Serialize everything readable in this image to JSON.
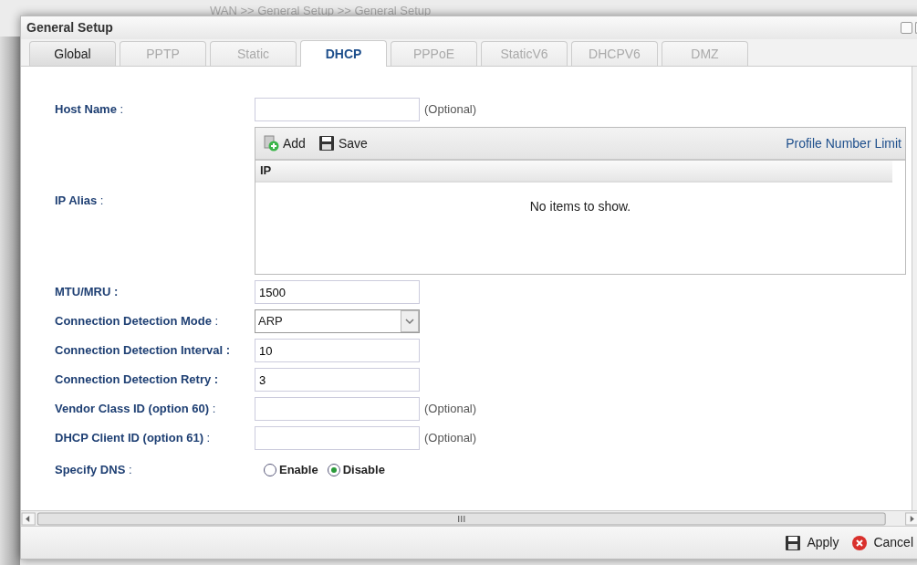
{
  "background": {
    "breadcrumb": "WAN >> General Setup >> General Setup"
  },
  "dialog": {
    "title": "General Setup"
  },
  "tabs": [
    {
      "label": "Global",
      "selected": false,
      "disabled": false
    },
    {
      "label": "PPTP",
      "selected": false,
      "disabled": true
    },
    {
      "label": "Static",
      "selected": false,
      "disabled": true
    },
    {
      "label": "DHCP",
      "selected": true,
      "disabled": false
    },
    {
      "label": "PPPoE",
      "selected": false,
      "disabled": true
    },
    {
      "label": "StaticV6",
      "selected": false,
      "disabled": true
    },
    {
      "label": "DHCPV6",
      "selected": false,
      "disabled": true
    },
    {
      "label": "DMZ",
      "selected": false,
      "disabled": true
    }
  ],
  "form": [
    {
      "kind": "text",
      "label": "**Host Name** :",
      "note": "(Optional)"
    },
    {
      "kind": "grid",
      "label": "**IP Alias** :",
      "toolbar": [
        {
          "kind": "add",
          "label": "Add"
        },
        {
          "kind": "save",
          "label": "Save"
        }
      ],
      "link": "Profile Number Limit",
      "columns": [
        "IP"
      ],
      "empty_text": "No items to show."
    },
    {
      "kind": "text",
      "label": "**MTU/MRU :**",
      "value": "1500"
    },
    {
      "kind": "select",
      "label": "**Connection Detection Mode** :",
      "value": "ARP"
    },
    {
      "kind": "text",
      "label": "**Connection Detection Interval :**",
      "value": "10"
    },
    {
      "kind": "text",
      "label": "**Connection Detection Retry :**",
      "value": "3"
    },
    {
      "kind": "text",
      "label": "**Vendor Class ID (option 60)** :",
      "note": "(Optional)"
    },
    {
      "kind": "text",
      "label": "**DHCP Client ID (option 61)** :",
      "note": "(Optional)"
    },
    {
      "kind": "radio",
      "label": "**Specify DNS** :",
      "options": [
        {
          "label": "Enable",
          "selected": false
        },
        {
          "label": "Disable",
          "selected": true
        }
      ]
    }
  ],
  "footer": [
    {
      "kind": "save",
      "label": "Apply"
    },
    {
      "kind": "cancel",
      "label": "Cancel"
    }
  ]
}
